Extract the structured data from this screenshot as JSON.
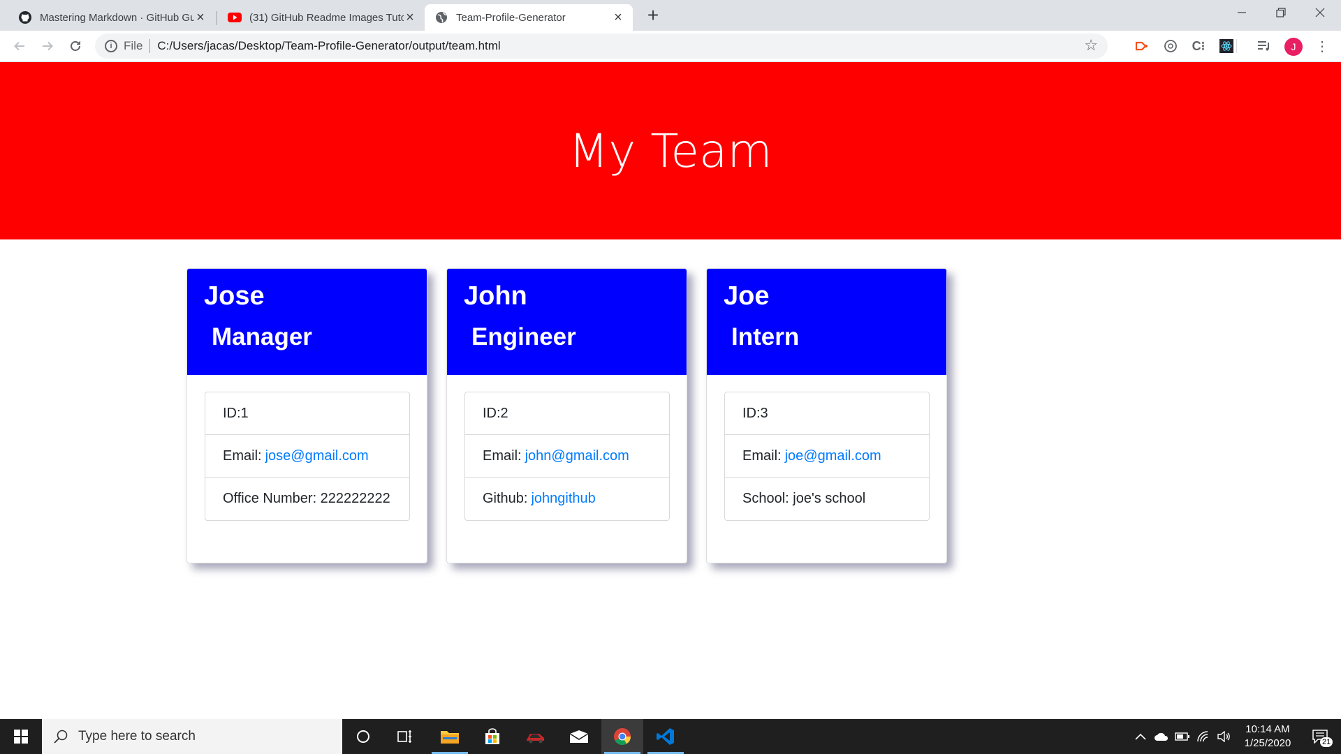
{
  "browser": {
    "tabs": [
      {
        "title": "Mastering Markdown · GitHub Gu",
        "icon": "github-icon"
      },
      {
        "title": "(31) GitHub Readme Images Tuto",
        "icon": "youtube-icon"
      },
      {
        "title": "Team-Profile-Generator",
        "icon": "globe-icon"
      }
    ],
    "address": {
      "scheme": "File",
      "url": "C:/Users/jacas/Desktop/Team-Profile-Generator/output/team.html"
    },
    "profile_initial": "J"
  },
  "page": {
    "heading": "My Team",
    "header_color": "#ff0000",
    "card_header_color": "#0000ff",
    "link_color": "#007bff",
    "cards": [
      {
        "name": "Jose",
        "role": "Manager",
        "id": "ID:1",
        "email_label": "Email:",
        "email": "jose@gmail.com",
        "extra": "Office Number: 222222222"
      },
      {
        "name": "John",
        "role": "Engineer",
        "id": "ID:2",
        "email_label": "Email:",
        "email": "john@gmail.com",
        "extra_label": "Github:",
        "extra_link": "johngithub"
      },
      {
        "name": "Joe",
        "role": "Intern",
        "id": "ID:3",
        "email_label": "Email:",
        "email": "joe@gmail.com",
        "extra": "School: joe's school"
      }
    ]
  },
  "taskbar": {
    "search_placeholder": "Type here to search",
    "time": "10:14 AM",
    "date": "1/25/2020",
    "notification_count": "21"
  }
}
